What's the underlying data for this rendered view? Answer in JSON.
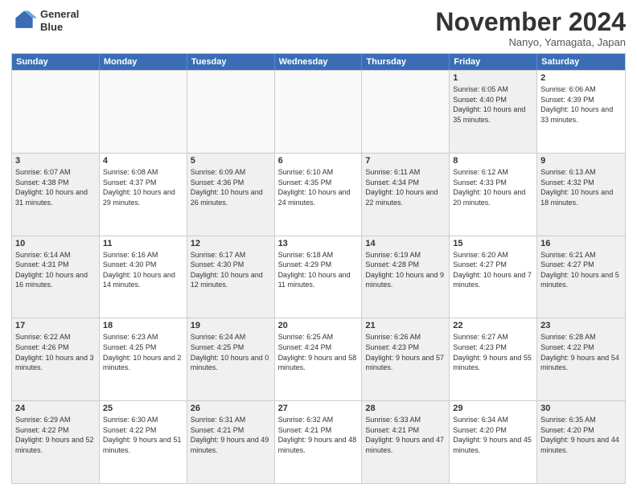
{
  "header": {
    "logo_line1": "General",
    "logo_line2": "Blue",
    "month": "November 2024",
    "location": "Nanyo, Yamagata, Japan"
  },
  "weekdays": [
    "Sunday",
    "Monday",
    "Tuesday",
    "Wednesday",
    "Thursday",
    "Friday",
    "Saturday"
  ],
  "rows": [
    [
      {
        "day": "",
        "text": "",
        "empty": true
      },
      {
        "day": "",
        "text": "",
        "empty": true
      },
      {
        "day": "",
        "text": "",
        "empty": true
      },
      {
        "day": "",
        "text": "",
        "empty": true
      },
      {
        "day": "",
        "text": "",
        "empty": true
      },
      {
        "day": "1",
        "text": "Sunrise: 6:05 AM\nSunset: 4:40 PM\nDaylight: 10 hours and 35 minutes.",
        "empty": false,
        "shaded": true
      },
      {
        "day": "2",
        "text": "Sunrise: 6:06 AM\nSunset: 4:39 PM\nDaylight: 10 hours and 33 minutes.",
        "empty": false,
        "shaded": false
      }
    ],
    [
      {
        "day": "3",
        "text": "Sunrise: 6:07 AM\nSunset: 4:38 PM\nDaylight: 10 hours and 31 minutes.",
        "empty": false,
        "shaded": true
      },
      {
        "day": "4",
        "text": "Sunrise: 6:08 AM\nSunset: 4:37 PM\nDaylight: 10 hours and 29 minutes.",
        "empty": false,
        "shaded": false
      },
      {
        "day": "5",
        "text": "Sunrise: 6:09 AM\nSunset: 4:36 PM\nDaylight: 10 hours and 26 minutes.",
        "empty": false,
        "shaded": true
      },
      {
        "day": "6",
        "text": "Sunrise: 6:10 AM\nSunset: 4:35 PM\nDaylight: 10 hours and 24 minutes.",
        "empty": false,
        "shaded": false
      },
      {
        "day": "7",
        "text": "Sunrise: 6:11 AM\nSunset: 4:34 PM\nDaylight: 10 hours and 22 minutes.",
        "empty": false,
        "shaded": true
      },
      {
        "day": "8",
        "text": "Sunrise: 6:12 AM\nSunset: 4:33 PM\nDaylight: 10 hours and 20 minutes.",
        "empty": false,
        "shaded": false
      },
      {
        "day": "9",
        "text": "Sunrise: 6:13 AM\nSunset: 4:32 PM\nDaylight: 10 hours and 18 minutes.",
        "empty": false,
        "shaded": true
      }
    ],
    [
      {
        "day": "10",
        "text": "Sunrise: 6:14 AM\nSunset: 4:31 PM\nDaylight: 10 hours and 16 minutes.",
        "empty": false,
        "shaded": true
      },
      {
        "day": "11",
        "text": "Sunrise: 6:16 AM\nSunset: 4:30 PM\nDaylight: 10 hours and 14 minutes.",
        "empty": false,
        "shaded": false
      },
      {
        "day": "12",
        "text": "Sunrise: 6:17 AM\nSunset: 4:30 PM\nDaylight: 10 hours and 12 minutes.",
        "empty": false,
        "shaded": true
      },
      {
        "day": "13",
        "text": "Sunrise: 6:18 AM\nSunset: 4:29 PM\nDaylight: 10 hours and 11 minutes.",
        "empty": false,
        "shaded": false
      },
      {
        "day": "14",
        "text": "Sunrise: 6:19 AM\nSunset: 4:28 PM\nDaylight: 10 hours and 9 minutes.",
        "empty": false,
        "shaded": true
      },
      {
        "day": "15",
        "text": "Sunrise: 6:20 AM\nSunset: 4:27 PM\nDaylight: 10 hours and 7 minutes.",
        "empty": false,
        "shaded": false
      },
      {
        "day": "16",
        "text": "Sunrise: 6:21 AM\nSunset: 4:27 PM\nDaylight: 10 hours and 5 minutes.",
        "empty": false,
        "shaded": true
      }
    ],
    [
      {
        "day": "17",
        "text": "Sunrise: 6:22 AM\nSunset: 4:26 PM\nDaylight: 10 hours and 3 minutes.",
        "empty": false,
        "shaded": true
      },
      {
        "day": "18",
        "text": "Sunrise: 6:23 AM\nSunset: 4:25 PM\nDaylight: 10 hours and 2 minutes.",
        "empty": false,
        "shaded": false
      },
      {
        "day": "19",
        "text": "Sunrise: 6:24 AM\nSunset: 4:25 PM\nDaylight: 10 hours and 0 minutes.",
        "empty": false,
        "shaded": true
      },
      {
        "day": "20",
        "text": "Sunrise: 6:25 AM\nSunset: 4:24 PM\nDaylight: 9 hours and 58 minutes.",
        "empty": false,
        "shaded": false
      },
      {
        "day": "21",
        "text": "Sunrise: 6:26 AM\nSunset: 4:23 PM\nDaylight: 9 hours and 57 minutes.",
        "empty": false,
        "shaded": true
      },
      {
        "day": "22",
        "text": "Sunrise: 6:27 AM\nSunset: 4:23 PM\nDaylight: 9 hours and 55 minutes.",
        "empty": false,
        "shaded": false
      },
      {
        "day": "23",
        "text": "Sunrise: 6:28 AM\nSunset: 4:22 PM\nDaylight: 9 hours and 54 minutes.",
        "empty": false,
        "shaded": true
      }
    ],
    [
      {
        "day": "24",
        "text": "Sunrise: 6:29 AM\nSunset: 4:22 PM\nDaylight: 9 hours and 52 minutes.",
        "empty": false,
        "shaded": true
      },
      {
        "day": "25",
        "text": "Sunrise: 6:30 AM\nSunset: 4:22 PM\nDaylight: 9 hours and 51 minutes.",
        "empty": false,
        "shaded": false
      },
      {
        "day": "26",
        "text": "Sunrise: 6:31 AM\nSunset: 4:21 PM\nDaylight: 9 hours and 49 minutes.",
        "empty": false,
        "shaded": true
      },
      {
        "day": "27",
        "text": "Sunrise: 6:32 AM\nSunset: 4:21 PM\nDaylight: 9 hours and 48 minutes.",
        "empty": false,
        "shaded": false
      },
      {
        "day": "28",
        "text": "Sunrise: 6:33 AM\nSunset: 4:21 PM\nDaylight: 9 hours and 47 minutes.",
        "empty": false,
        "shaded": true
      },
      {
        "day": "29",
        "text": "Sunrise: 6:34 AM\nSunset: 4:20 PM\nDaylight: 9 hours and 45 minutes.",
        "empty": false,
        "shaded": false
      },
      {
        "day": "30",
        "text": "Sunrise: 6:35 AM\nSunset: 4:20 PM\nDaylight: 9 hours and 44 minutes.",
        "empty": false,
        "shaded": true
      }
    ]
  ]
}
